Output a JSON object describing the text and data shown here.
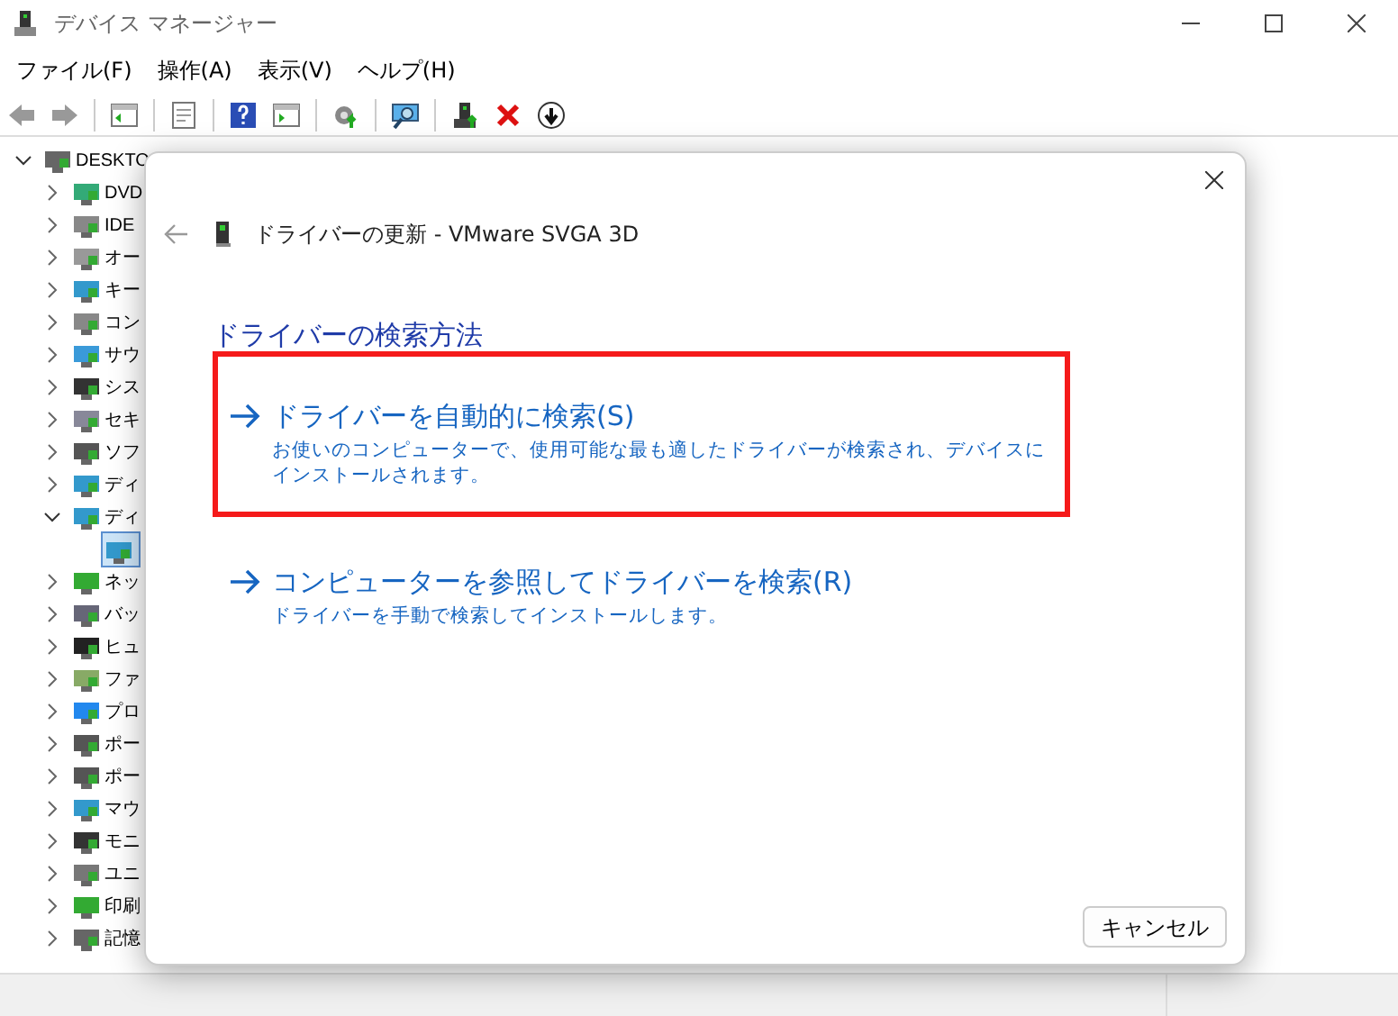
{
  "window": {
    "title": "デバイス マネージャー"
  },
  "menu": [
    {
      "label": "ファイル(F)"
    },
    {
      "label": "操作(A)"
    },
    {
      "label": "表示(V)"
    },
    {
      "label": "ヘルプ(H)"
    }
  ],
  "tree": {
    "label": "DESKTO",
    "expanded": true,
    "children": [
      {
        "label": "DVD",
        "expanded": false
      },
      {
        "label": "IDE",
        "expanded": false
      },
      {
        "label": "オー",
        "expanded": false
      },
      {
        "label": "キー",
        "expanded": false
      },
      {
        "label": "コン",
        "expanded": false
      },
      {
        "label": "サウ",
        "expanded": false
      },
      {
        "label": "シス",
        "expanded": false
      },
      {
        "label": "セキ",
        "expanded": false
      },
      {
        "label": "ソフ",
        "expanded": false
      },
      {
        "label": "ディ",
        "expanded": false
      },
      {
        "label": "ディ",
        "expanded": true,
        "children": [
          {
            "selected": true
          }
        ]
      },
      {
        "label": "ネッ",
        "expanded": false
      },
      {
        "label": "バッ",
        "expanded": false
      },
      {
        "label": "ヒュ",
        "expanded": false
      },
      {
        "label": "ファ",
        "expanded": false
      },
      {
        "label": "プロ",
        "expanded": false
      },
      {
        "label": "ポー",
        "expanded": false
      },
      {
        "label": "ポー",
        "expanded": false
      },
      {
        "label": "マウ",
        "expanded": false
      },
      {
        "label": "モニ",
        "expanded": false
      },
      {
        "label": "ユニ",
        "expanded": false
      },
      {
        "label": "印刷",
        "expanded": false
      },
      {
        "label": "記憶",
        "expanded": false
      }
    ]
  },
  "dialog": {
    "title": "ドライバーの更新 - VMware SVGA 3D",
    "heading": "ドライバーの検索方法",
    "options": [
      {
        "title": "ドライバーを自動的に検索(S)",
        "description": "お使いのコンピューターで、使用可能な最も適したドライバーが検索され、デバイスにインストールされます。",
        "highlighted": true
      },
      {
        "title": "コンピューターを参照してドライバーを検索(R)",
        "description": "ドライバーを手動で検索してインストールします。",
        "highlighted": false
      }
    ],
    "cancel": "キャンセル"
  }
}
